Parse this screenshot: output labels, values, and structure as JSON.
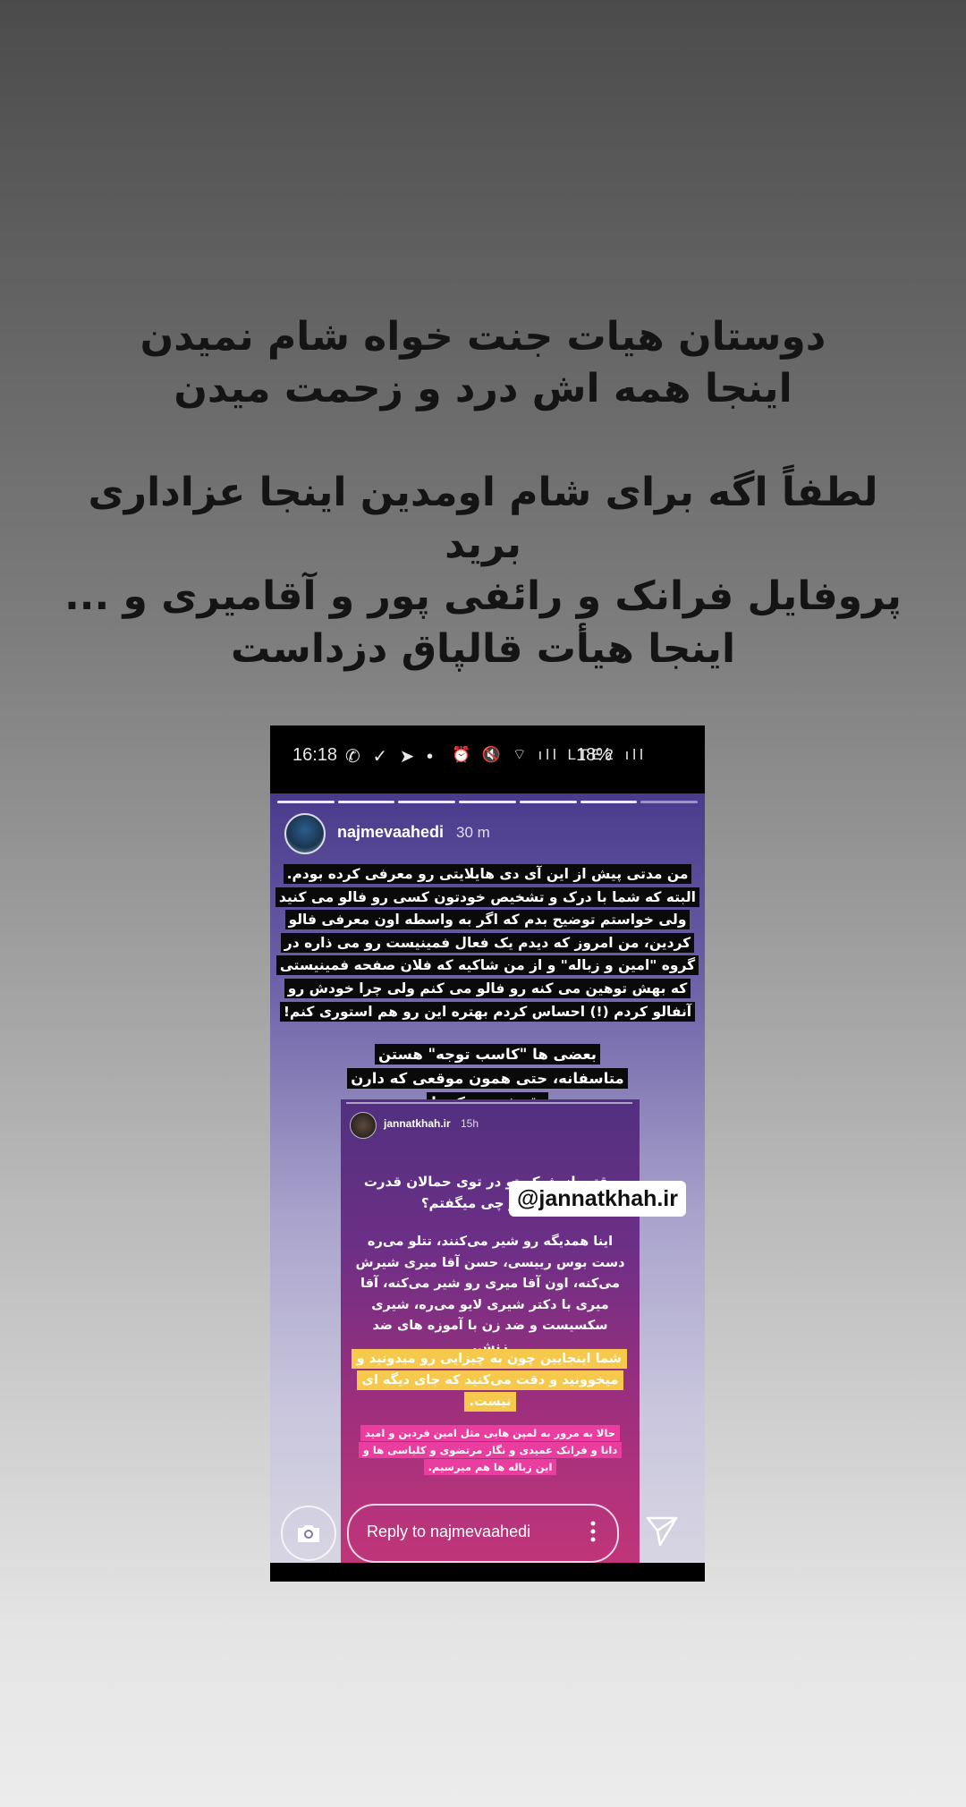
{
  "caption": {
    "block1": "دوستان هیات جنت خواه شام نمیدن\nاینجا همه اش درد و زحمت میدن",
    "block2": "لطفاً اگه برای شام اومدین اینجا عزاداری برید\nپروفایل فرانک و رائفی پور و آقامیری و ...",
    "block3": "اینجا هیأت قالپاق دزداست"
  },
  "status_bar": {
    "time": "16:18",
    "left_icons": "✆ ✓ ➤ •",
    "right_icons": "⏰ 🔇 ⌔ ıll LTE2 ıll",
    "battery": "18%"
  },
  "story": {
    "username": "najmevaahedi",
    "time_ago": "30 m",
    "paragraph1": "من مدتی پیش از این آی دی هایلایتی رو معرفی کرده بودم. البته که شما با درک و تشخیص خودتون کسی رو فالو می کنید ولی خواستم توضیح بدم که اگر به واسطه اون معرفی فالو کردین، من امروز که دیدم یک فعال فمینیست رو می ذاره در گروه \"امین و زباله\" و از من شاکیه که فلان صفحه فمینیستی که بهش توهین می کنه رو فالو می کنم ولی چرا خودش رو آنفالو کردم (!) احساس کردم بهتره این رو هم استوری کنم!",
    "paragraph2": "بعضی ها \"کاسب توجه\" هستن متاسفانه، حتی همون موقعی که دارن نقدش می کنن!",
    "mention_tag": "@jannatkhah.ir"
  },
  "inner_story": {
    "username": "jannatkhah.ir",
    "time_ago": "15h",
    "line1": "وقتی از شبکه تو در توی حمالان قدرت گفتم از چی میگفتم؟",
    "line2": "اینا همدیگه رو شیر می‌کنند، تتلو می‌ره دست بوس رییسی، حسن آقا میری شیرش می‌کنه، اون آقا میری رو شیر می‌کنه، آقا میری با دکتر شیری لایو می‌ره، شیری سکسیست و ضد زن با آموزه های ضد زنش.",
    "highlight_yellow": "شما اینجایین چون به چیزایی رو میدونید و میخوونید و دقت می‌کنید که جای دیگه ای نیست.",
    "highlight_pink": "حالا به مرور به لمپن هایی مثل امین فردین و امید دانا و فرانک عمیدی و نگار مرتضوی و کلباسی ها و این زباله ها هم میرسیم."
  },
  "reply_bar": {
    "placeholder": "Reply to najmevaahedi",
    "camera_icon": "camera-icon",
    "send_icon": "send-icon"
  },
  "nav_bar": {
    "recents_icon": "recents-icon",
    "home_icon": "home-icon",
    "back_icon": "back-icon"
  },
  "colors": {
    "highlight_yellow": "#f6c94c",
    "highlight_pink": "#ea3da0",
    "text_block_bg": "#0a0a0a"
  }
}
